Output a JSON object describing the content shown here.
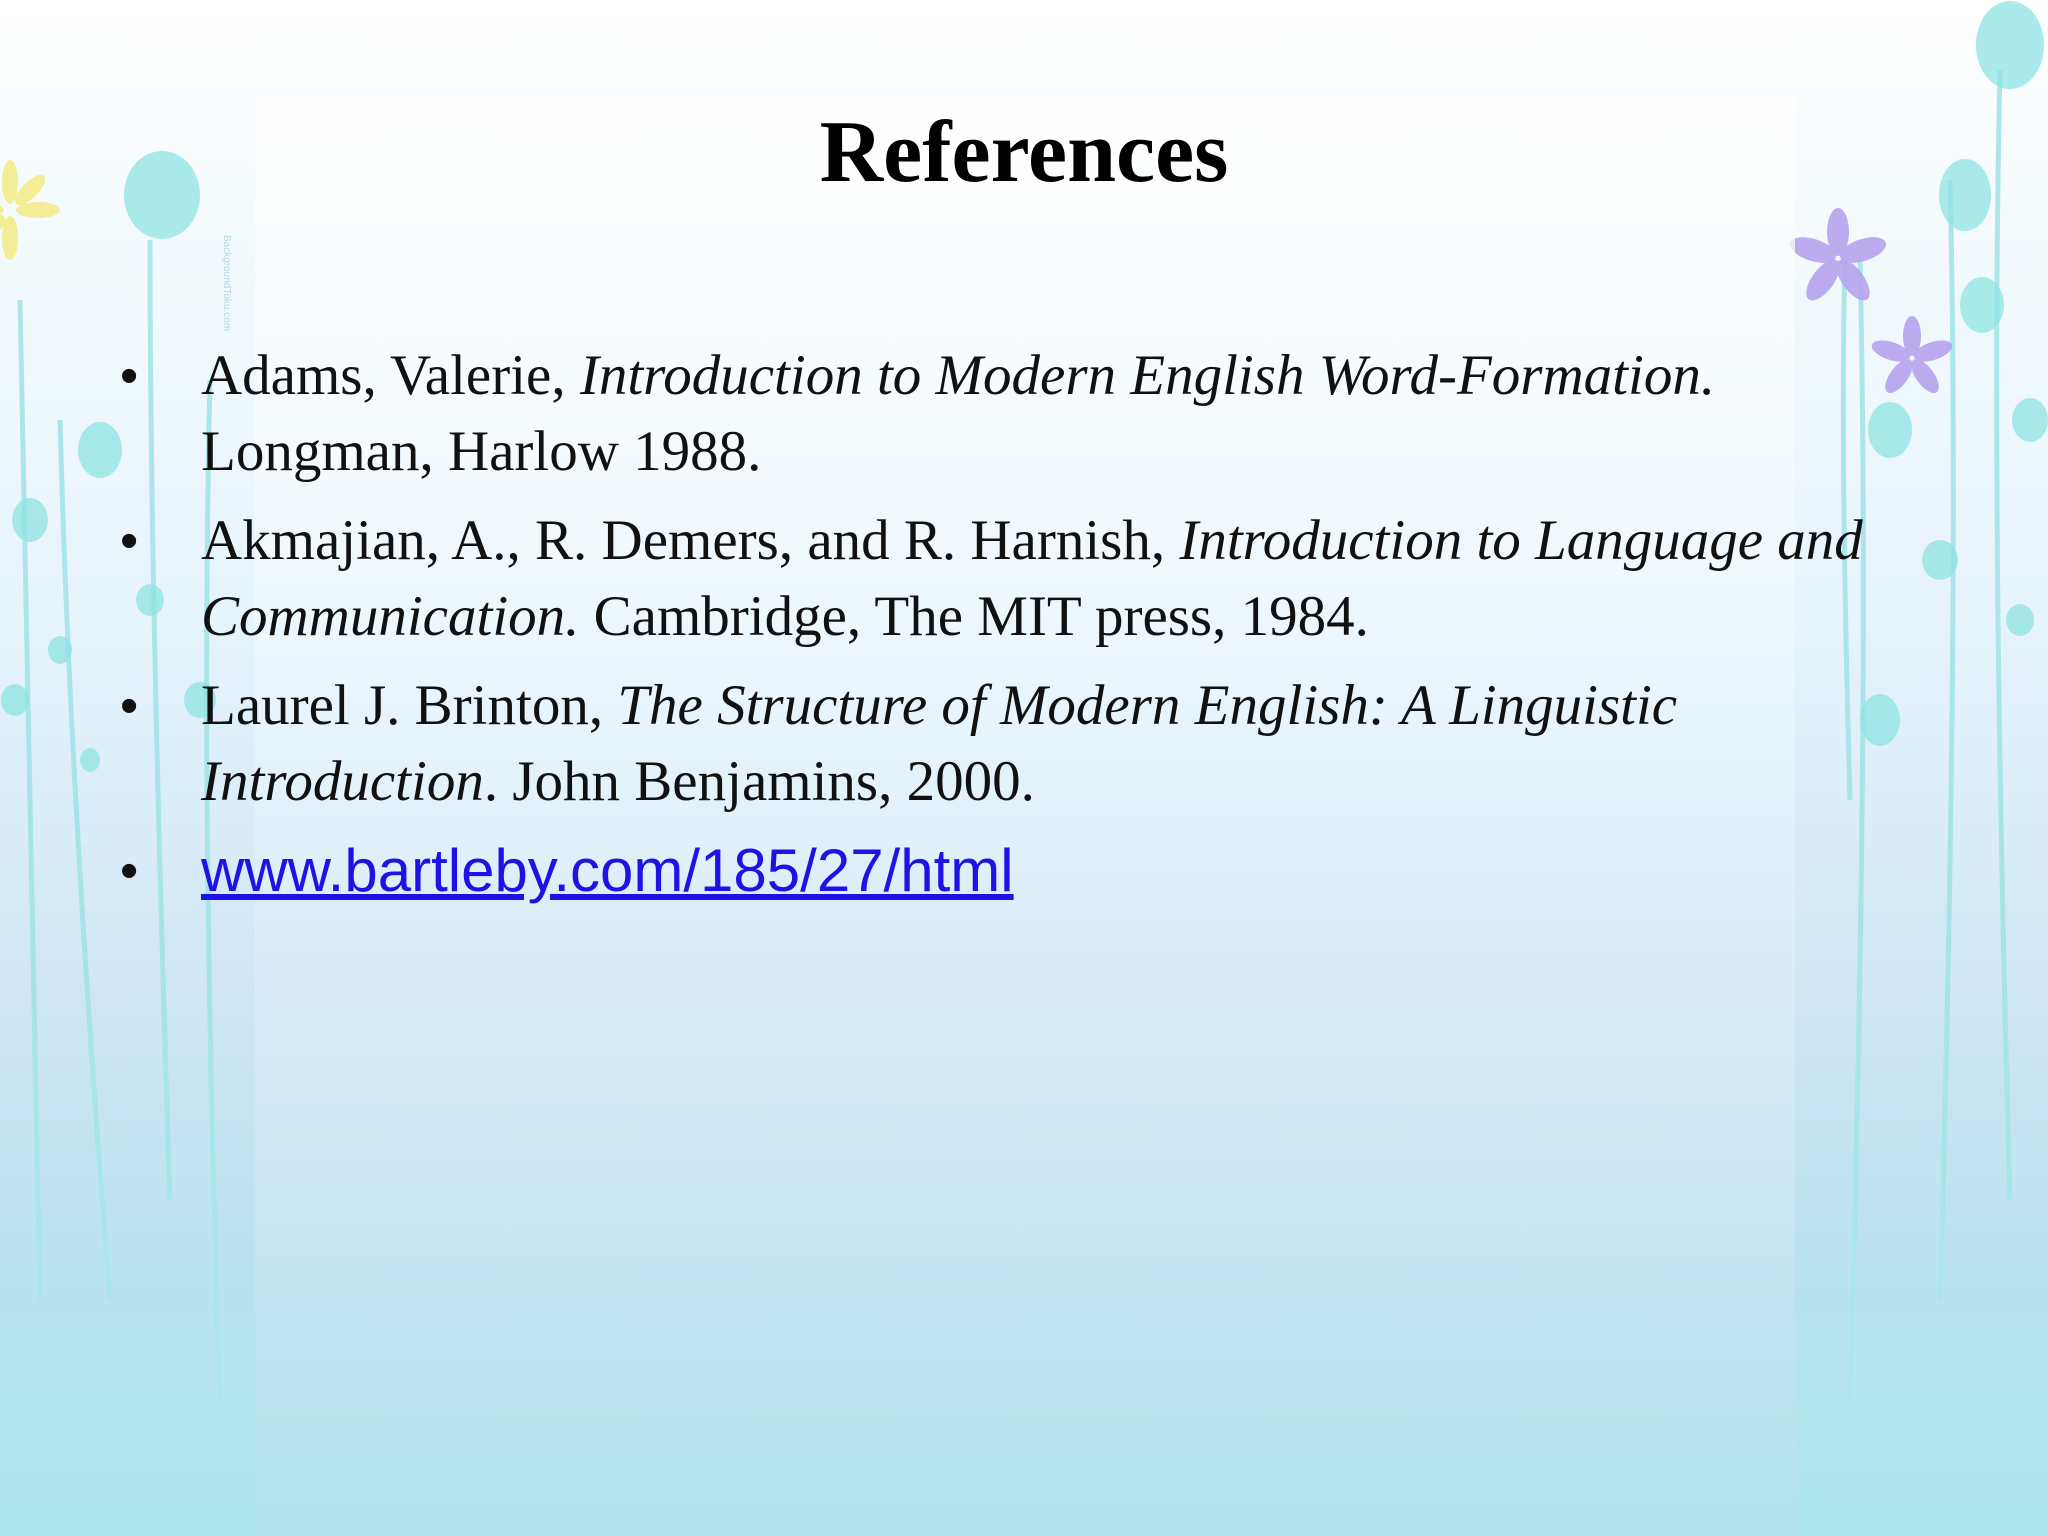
{
  "slide": {
    "title": "References",
    "references": [
      {
        "author": "Adams, Valerie, ",
        "work": "Introduction to Modern English Word-Formation.",
        "publication": " Longman, Harlow 1988."
      },
      {
        "author": "Akmajian, A., R. Demers, and R. Harnish, ",
        "work": "Introduction to Language and Communication.",
        "publication": " Cambridge, The MIT press, 1984."
      },
      {
        "author": "Laurel J. Brinton, ",
        "work": "The Structure of Modern English: A Linguistic Introduction",
        "publication": ". John Benjamins, 2000."
      }
    ],
    "link": "www.bartleby.com/185/27/html",
    "watermark": "BackgroundToku.com"
  },
  "colors": {
    "link": "#1e13e6",
    "title": "#000000",
    "accent_teal": "#8fe3e3",
    "accent_purple": "#b7a3ee"
  },
  "icons": [
    "bullet-icon",
    "flower-icon",
    "plant-decoration"
  ]
}
